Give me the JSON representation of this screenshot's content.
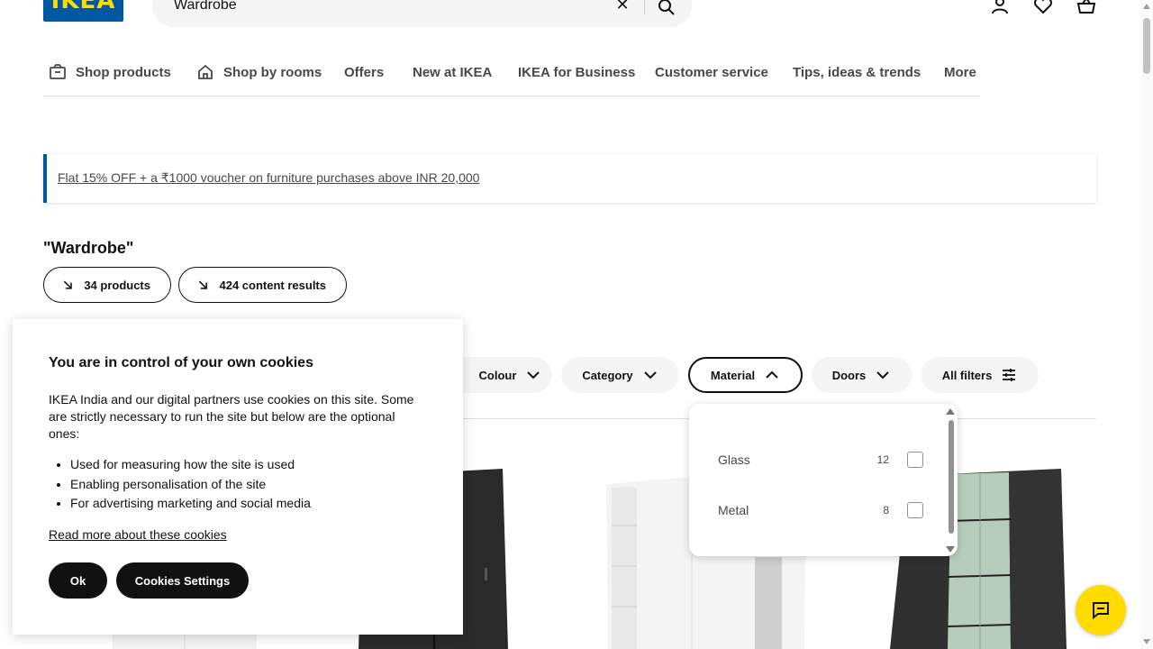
{
  "header": {
    "logo_text": "IKEA",
    "search_value": "Wardrobe",
    "icons": [
      "close-icon",
      "search-icon",
      "user-icon",
      "heart-icon",
      "basket-icon"
    ]
  },
  "nav": {
    "items": [
      {
        "label": "Shop products",
        "icon": "box-icon"
      },
      {
        "label": "Shop by rooms",
        "icon": "home-icon"
      },
      {
        "label": "Offers"
      },
      {
        "label": "New at IKEA"
      },
      {
        "label": "IKEA for Business"
      },
      {
        "label": "Customer service"
      },
      {
        "label": "Tips, ideas & trends"
      },
      {
        "label": "More"
      }
    ]
  },
  "promo": {
    "text": "Flat 15% OFF + a ₹1000 voucher on furniture purchases above INR 20,000",
    "accent_color": "#0058a3"
  },
  "results": {
    "title": "\"Wardrobe\"",
    "products_pill": "34 products",
    "content_pill": "424 content results"
  },
  "filters": {
    "colour": "Colour",
    "category": "Category",
    "material": "Material",
    "doors": "Doors",
    "all_filters": "All filters"
  },
  "material_dropdown": {
    "options": [
      {
        "label": "Glass",
        "count": "12",
        "checked": false
      },
      {
        "label": "Metal",
        "count": "8",
        "checked": false
      }
    ]
  },
  "cookie": {
    "title": "You are in control of your own cookies",
    "body": "IKEA India and our digital partners use cookies on this site. Some are strictly necessary to run the site but below are the optional ones:",
    "bullets": [
      "Used for measuring how the site is used",
      "Enabling personalisation of the site",
      "For advertising marketing and social media"
    ],
    "read_more": "Read more about these cookies",
    "ok_label": "Ok",
    "settings_label": "Cookies Settings"
  },
  "colors": {
    "brand_blue": "#0058a3",
    "brand_yellow": "#ffdb00",
    "text_dark": "#111111",
    "text_grey": "#484848"
  }
}
